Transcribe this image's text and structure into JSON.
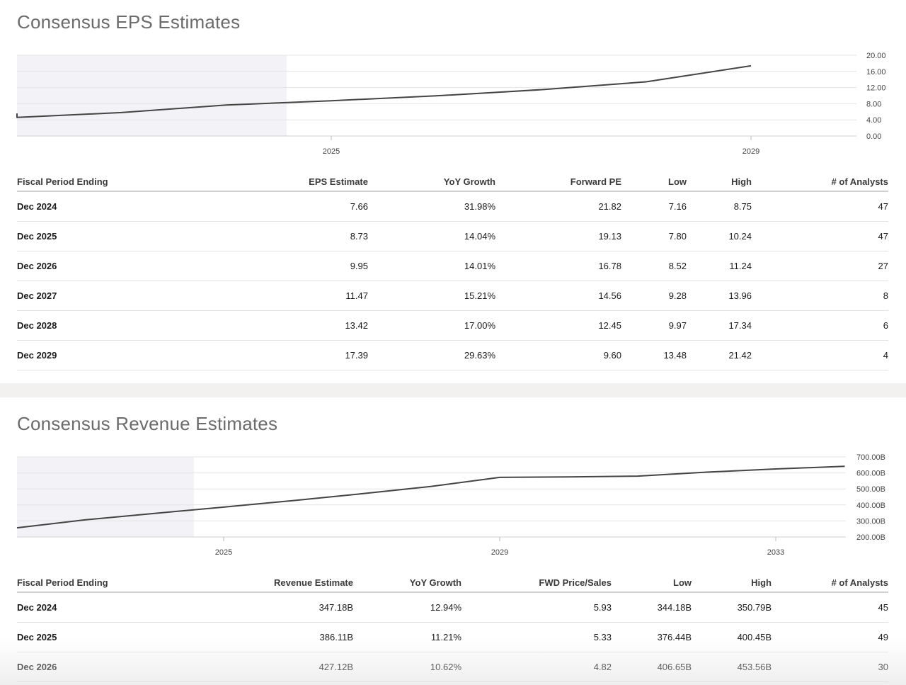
{
  "eps": {
    "title": "Consensus EPS Estimates",
    "columns": [
      "Fiscal Period Ending",
      "EPS Estimate",
      "YoY Growth",
      "Forward PE",
      "Low",
      "High",
      "# of Analysts"
    ],
    "rows": [
      [
        "Dec 2024",
        "7.66",
        "31.98%",
        "21.82",
        "7.16",
        "8.75",
        "47"
      ],
      [
        "Dec 2025",
        "8.73",
        "14.04%",
        "19.13",
        "7.80",
        "10.24",
        "47"
      ],
      [
        "Dec 2026",
        "9.95",
        "14.01%",
        "16.78",
        "8.52",
        "11.24",
        "27"
      ],
      [
        "Dec 2027",
        "11.47",
        "15.21%",
        "14.56",
        "9.28",
        "13.96",
        "8"
      ],
      [
        "Dec 2028",
        "13.42",
        "17.00%",
        "12.45",
        "9.97",
        "17.34",
        "6"
      ],
      [
        "Dec 2029",
        "17.39",
        "29.63%",
        "9.60",
        "13.48",
        "21.42",
        "4"
      ]
    ],
    "chart_data": {
      "type": "line",
      "x": [
        "2021",
        "2022",
        "2023",
        "2024",
        "2025",
        "2026",
        "2027",
        "2028",
        "2029",
        "2030"
      ],
      "values": [
        5.6,
        4.6,
        5.8,
        7.66,
        8.73,
        9.95,
        11.47,
        13.42,
        17.39
      ],
      "x_positions": [
        2021,
        2022,
        2023,
        2024,
        2025,
        2026,
        2027,
        2028,
        2029
      ],
      "y_ticks": [
        "20.00",
        "16.00",
        "12.00",
        "8.00",
        "4.00",
        "0.00"
      ],
      "ylim": [
        0,
        20
      ],
      "x_ticks": [
        "2025",
        "2029"
      ],
      "actuals_through": "2023",
      "line_color": "#444444",
      "shade_color": "#f2f2f7"
    }
  },
  "revenue": {
    "title": "Consensus Revenue Estimates",
    "columns": [
      "Fiscal Period Ending",
      "Revenue Estimate",
      "YoY Growth",
      "FWD Price/Sales",
      "Low",
      "High",
      "# of Analysts"
    ],
    "rows": [
      [
        "Dec 2024",
        "347.18B",
        "12.94%",
        "5.93",
        "344.18B",
        "350.79B",
        "45"
      ],
      [
        "Dec 2025",
        "386.11B",
        "11.21%",
        "5.33",
        "376.44B",
        "400.45B",
        "49"
      ],
      [
        "Dec 2026",
        "427.12B",
        "10.62%",
        "4.82",
        "406.65B",
        "453.56B",
        "30"
      ]
    ],
    "chart_data": {
      "type": "line",
      "x_positions": [
        2022,
        2023,
        2024,
        2025,
        2026,
        2027,
        2028,
        2029,
        2030,
        2031,
        2032,
        2033,
        2034
      ],
      "values": [
        257,
        307,
        347.18,
        386.11,
        427.12,
        470,
        515,
        572,
        575,
        580,
        605,
        625,
        641
      ],
      "y_ticks": [
        "700.00B",
        "600.00B",
        "500.00B",
        "400.00B",
        "300.00B",
        "200.00B"
      ],
      "ylim": [
        200,
        700
      ],
      "x_ticks": [
        "2025",
        "2029",
        "2033"
      ],
      "actuals_through": "2023",
      "line_color": "#444444",
      "shade_color": "#f2f2f7"
    }
  }
}
